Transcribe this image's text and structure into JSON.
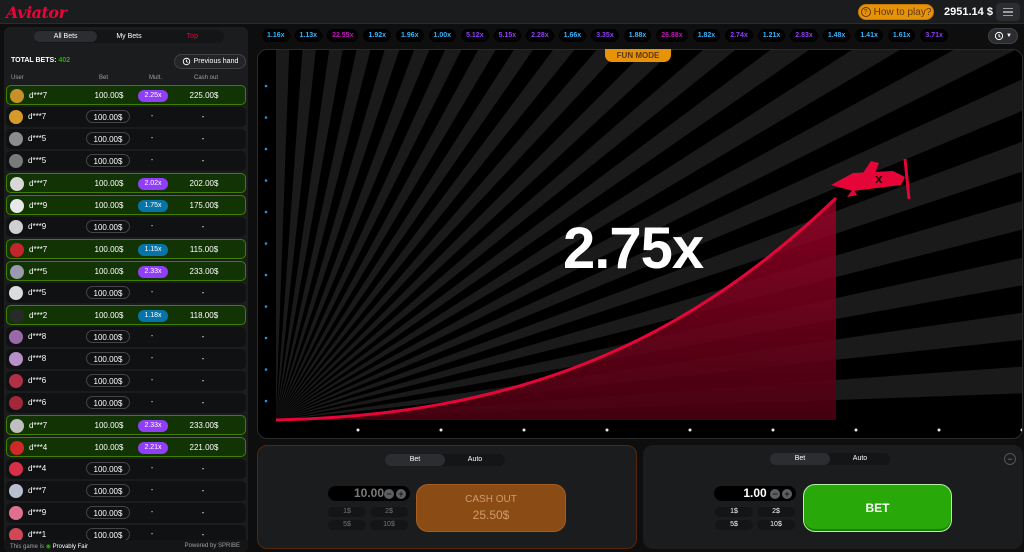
{
  "header": {
    "logo": "Aviator",
    "how_to_play": "How to play?",
    "balance": "2951.14 $"
  },
  "left": {
    "tabs": [
      "All Bets",
      "My Bets",
      "Top"
    ],
    "total_label": "TOTAL BETS:",
    "total_value": "402",
    "prev_hand": "Previous hand",
    "cols": {
      "user": "User",
      "bet": "Bet",
      "mult": "Mult.",
      "cashout": "Cash out"
    },
    "rows": [
      {
        "user": "d***7",
        "bet": "100.00$",
        "mult": "2.25x",
        "cashout": "225.00$",
        "win": true,
        "mcolor": "#913ef8",
        "av": "#c8902a"
      },
      {
        "user": "d***7",
        "bet": "100.00$",
        "mult": "-",
        "cashout": "-",
        "win": false,
        "mcolor": "",
        "av": "#d69a2a"
      },
      {
        "user": "d***5",
        "bet": "100.00$",
        "mult": "-",
        "cashout": "-",
        "win": false,
        "mcolor": "",
        "av": "#8c8c8c"
      },
      {
        "user": "d***5",
        "bet": "100.00$",
        "mult": "-",
        "cashout": "-",
        "win": false,
        "mcolor": "",
        "av": "#7a7a7a"
      },
      {
        "user": "d***7",
        "bet": "100.00$",
        "mult": "2.02x",
        "cashout": "202.00$",
        "win": true,
        "mcolor": "#913ef8",
        "av": "#d8d8d8"
      },
      {
        "user": "d***9",
        "bet": "100.00$",
        "mult": "1.75x",
        "cashout": "175.00$",
        "win": true,
        "mcolor": "#0674a8",
        "av": "#e8e8e8"
      },
      {
        "user": "d***9",
        "bet": "100.00$",
        "mult": "-",
        "cashout": "-",
        "win": false,
        "mcolor": "",
        "av": "#cfcfcf"
      },
      {
        "user": "d***7",
        "bet": "100.00$",
        "mult": "1.15x",
        "cashout": "115.00$",
        "win": true,
        "mcolor": "#0674a8",
        "av": "#c0262b"
      },
      {
        "user": "d***5",
        "bet": "100.00$",
        "mult": "2.33x",
        "cashout": "233.00$",
        "win": true,
        "mcolor": "#913ef8",
        "av": "#9a9ab0"
      },
      {
        "user": "d***5",
        "bet": "100.00$",
        "mult": "-",
        "cashout": "-",
        "win": false,
        "mcolor": "",
        "av": "#dcdcdc"
      },
      {
        "user": "d***2",
        "bet": "100.00$",
        "mult": "1.18x",
        "cashout": "118.00$",
        "win": true,
        "mcolor": "#0674a8",
        "av": "#2a2a2a"
      },
      {
        "user": "d***8",
        "bet": "100.00$",
        "mult": "-",
        "cashout": "-",
        "win": false,
        "mcolor": "",
        "av": "#9a6aa8"
      },
      {
        "user": "d***8",
        "bet": "100.00$",
        "mult": "-",
        "cashout": "-",
        "win": false,
        "mcolor": "",
        "av": "#b890c8"
      },
      {
        "user": "d***6",
        "bet": "100.00$",
        "mult": "-",
        "cashout": "-",
        "win": false,
        "mcolor": "",
        "av": "#b03048"
      },
      {
        "user": "d***6",
        "bet": "100.00$",
        "mult": "-",
        "cashout": "-",
        "win": false,
        "mcolor": "",
        "av": "#a02838"
      },
      {
        "user": "d***7",
        "bet": "100.00$",
        "mult": "2.33x",
        "cashout": "233.00$",
        "win": true,
        "mcolor": "#913ef8",
        "av": "#bfbfbf"
      },
      {
        "user": "d***4",
        "bet": "100.00$",
        "mult": "2.21x",
        "cashout": "221.00$",
        "win": true,
        "mcolor": "#913ef8",
        "av": "#d02828"
      },
      {
        "user": "d***4",
        "bet": "100.00$",
        "mult": "-",
        "cashout": "-",
        "win": false,
        "mcolor": "",
        "av": "#d83048"
      },
      {
        "user": "d***7",
        "bet": "100.00$",
        "mult": "-",
        "cashout": "-",
        "win": false,
        "mcolor": "",
        "av": "#b8c0d0"
      },
      {
        "user": "d***9",
        "bet": "100.00$",
        "mult": "-",
        "cashout": "-",
        "win": false,
        "mcolor": "",
        "av": "#e07090"
      },
      {
        "user": "d***1",
        "bet": "100.00$",
        "mult": "-",
        "cashout": "-",
        "win": false,
        "mcolor": "",
        "av": "#d04858"
      }
    ],
    "footer_left": "This game is",
    "footer_fair": "Provably Fair",
    "footer_right": "Powered by SPRIBE"
  },
  "history": [
    {
      "v": "1.16x",
      "c": "#34b4ff"
    },
    {
      "v": "1.13x",
      "c": "#34b4ff"
    },
    {
      "v": "22.55x",
      "c": "#c017b4"
    },
    {
      "v": "1.92x",
      "c": "#34b4ff"
    },
    {
      "v": "1.96x",
      "c": "#34b4ff"
    },
    {
      "v": "1.00x",
      "c": "#34b4ff"
    },
    {
      "v": "5.12x",
      "c": "#913ef8"
    },
    {
      "v": "5.15x",
      "c": "#913ef8"
    },
    {
      "v": "2.28x",
      "c": "#913ef8"
    },
    {
      "v": "1.66x",
      "c": "#34b4ff"
    },
    {
      "v": "3.35x",
      "c": "#913ef8"
    },
    {
      "v": "1.88x",
      "c": "#34b4ff"
    },
    {
      "v": "26.88x",
      "c": "#c017b4"
    },
    {
      "v": "1.82x",
      "c": "#34b4ff"
    },
    {
      "v": "2.74x",
      "c": "#913ef8"
    },
    {
      "v": "1.21x",
      "c": "#34b4ff"
    },
    {
      "v": "2.83x",
      "c": "#913ef8"
    },
    {
      "v": "1.48x",
      "c": "#34b4ff"
    },
    {
      "v": "1.41x",
      "c": "#34b4ff"
    },
    {
      "v": "1.61x",
      "c": "#34b4ff"
    },
    {
      "v": "3.71x",
      "c": "#913ef8"
    }
  ],
  "stage": {
    "fun_mode": "FUN MODE",
    "multiplier": "2.75x",
    "curve_color": "#e50539"
  },
  "panel1": {
    "tab_bet": "Bet",
    "tab_auto": "Auto",
    "amount": "10.00",
    "quick": [
      "1$",
      "2$",
      "5$",
      "10$"
    ],
    "cashout_label": "CASH OUT",
    "cashout_value": "25.50$"
  },
  "panel2": {
    "tab_bet": "Bet",
    "tab_auto": "Auto",
    "amount": "1.00",
    "quick": [
      "1$",
      "2$",
      "5$",
      "10$"
    ],
    "bet_label": "BET"
  }
}
